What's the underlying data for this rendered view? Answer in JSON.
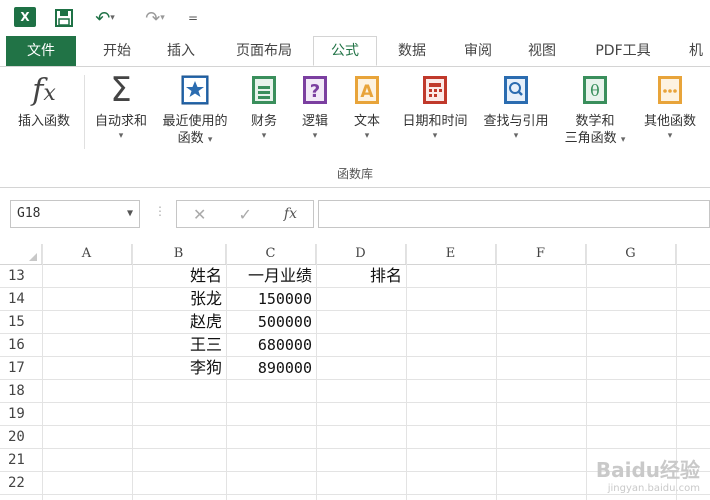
{
  "quick_access": {
    "app_icon": "X",
    "more": "="
  },
  "tabs": [
    "文件",
    "开始",
    "插入",
    "页面布局",
    "公式",
    "数据",
    "审阅",
    "视图",
    "PDF工具",
    "机"
  ],
  "active_tab_index": 4,
  "ribbon": {
    "buttons": [
      {
        "label": "插入函数",
        "icon": "fx-icon"
      },
      {
        "label": "自动求和",
        "icon": "sigma-icon"
      },
      {
        "label": "最近使用的",
        "label2": "函数",
        "icon": "star-book-icon"
      },
      {
        "label": "财务",
        "icon": "finance-book-icon"
      },
      {
        "label": "逻辑",
        "icon": "question-book-icon"
      },
      {
        "label": "文本",
        "icon": "text-book-icon"
      },
      {
        "label": "日期和时间",
        "icon": "calendar-book-icon"
      },
      {
        "label": "查找与引用",
        "icon": "search-book-icon"
      },
      {
        "label": "数学和",
        "label2": "三角函数",
        "icon": "theta-book-icon"
      },
      {
        "label": "其他函数",
        "icon": "more-book-icon"
      }
    ],
    "group_label": "函数库"
  },
  "formula_bar": {
    "name_box": "G18",
    "fx": "fx",
    "value": ""
  },
  "columns": [
    "A",
    "B",
    "C",
    "D",
    "E",
    "F",
    "G"
  ],
  "rows": [
    "13",
    "14",
    "15",
    "16",
    "17",
    "18",
    "19",
    "20",
    "21",
    "22"
  ],
  "cells": {
    "B13": "姓名",
    "C13": "一月业绩",
    "D13": "排名",
    "B14": "张龙",
    "C14": "150000",
    "B15": "赵虎",
    "C15": "500000",
    "B16": "王三",
    "C16": "680000",
    "B17": "李狗",
    "C17": "890000"
  },
  "watermark": {
    "brand": "Baidu经验",
    "url": "jingyan.baidu.com"
  },
  "colors": {
    "accent": "#217346"
  }
}
